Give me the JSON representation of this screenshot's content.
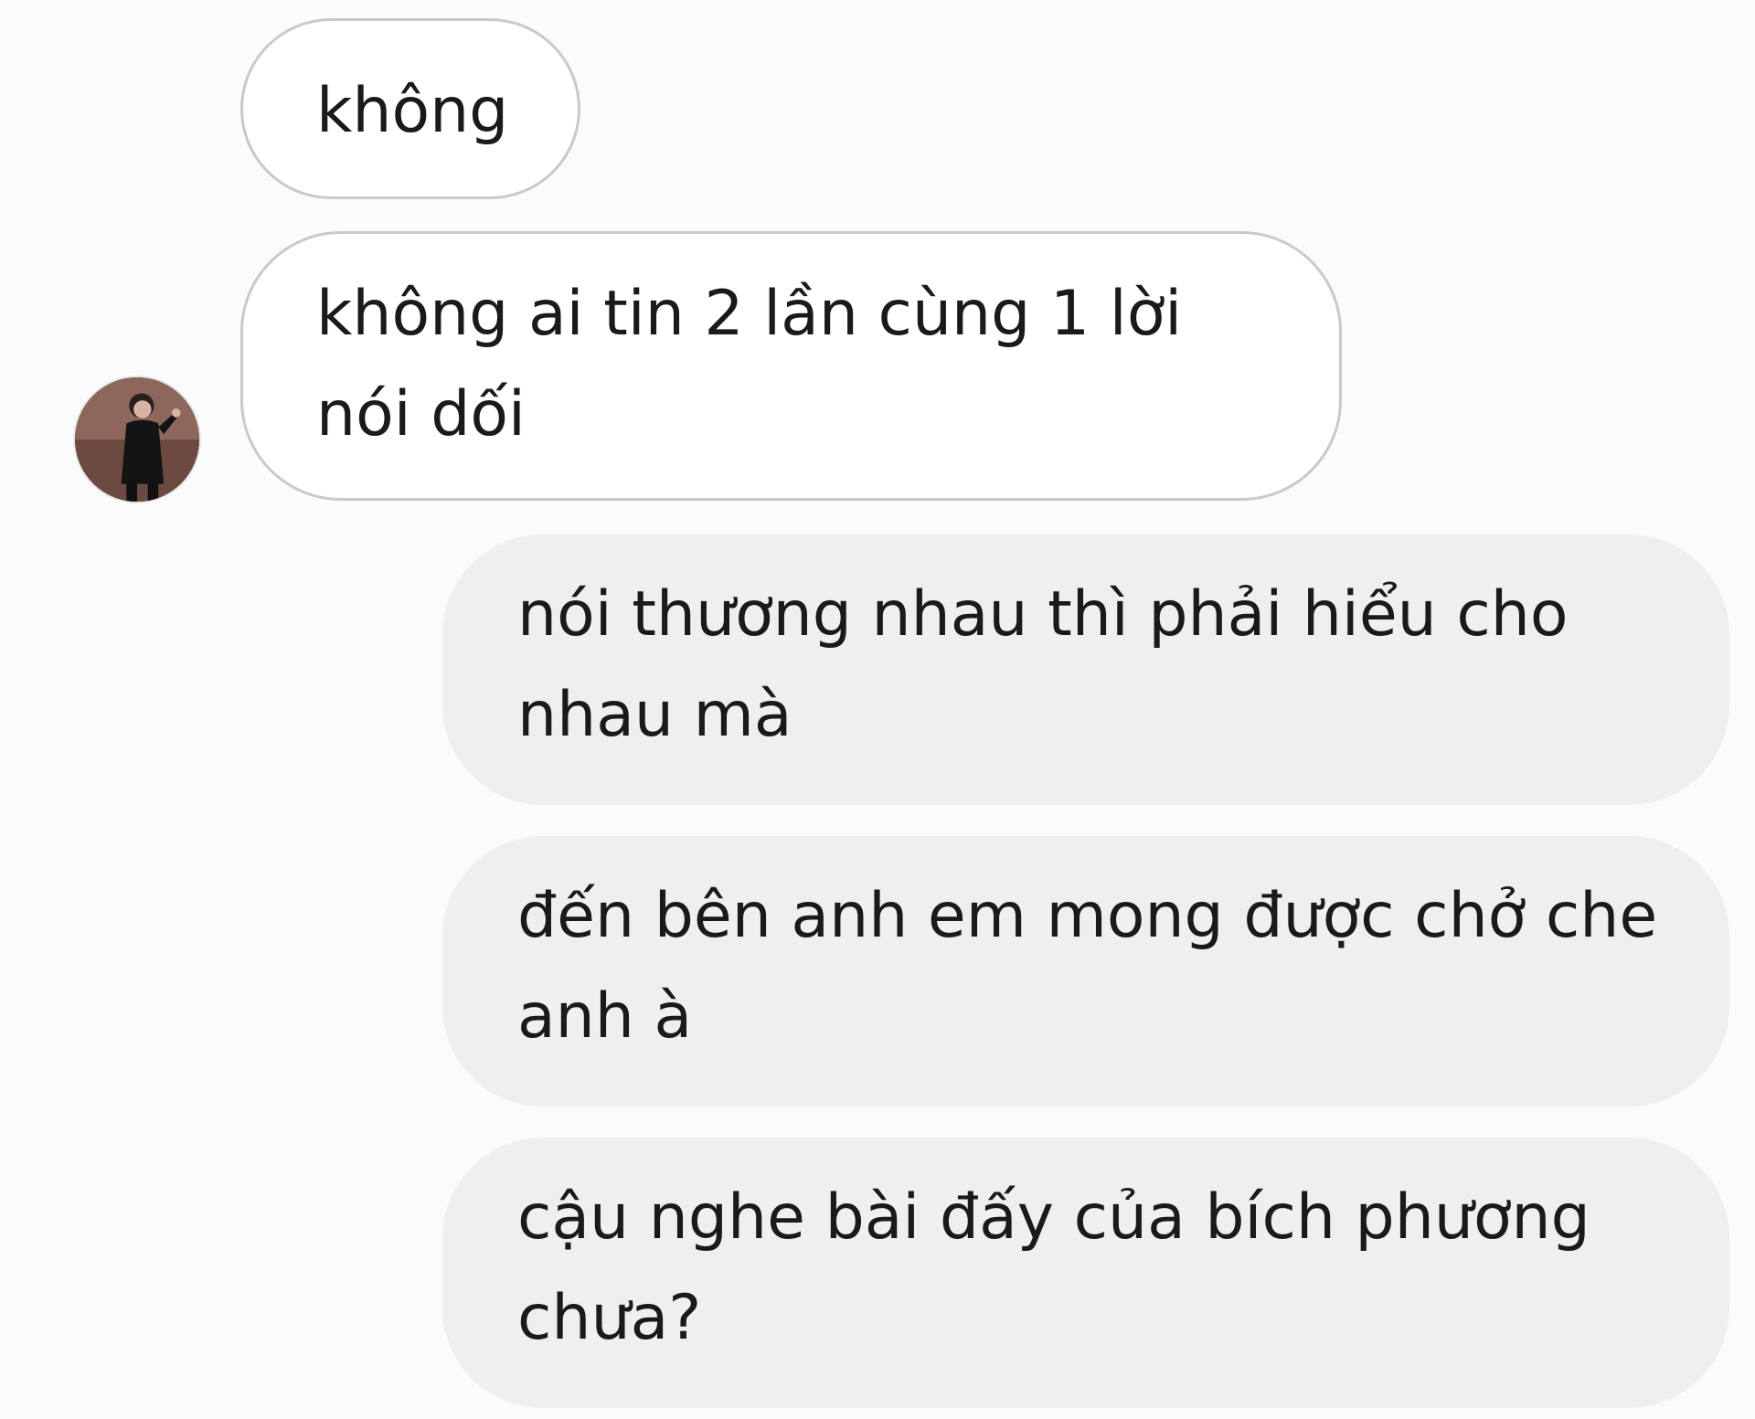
{
  "conversation": {
    "incoming": [
      {
        "text": "không"
      },
      {
        "text": "không ai tin 2 lần cùng 1 lời nói dối"
      }
    ],
    "outgoing": [
      {
        "text": "nói thương nhau thì phải hiểu cho nhau mà"
      },
      {
        "text": "đến bên anh em mong được chở che anh à"
      },
      {
        "text": "cậu nghe bài đấy của bích phương chưa?"
      }
    ]
  },
  "avatar": {
    "icon": "contact-avatar-photo"
  },
  "colors": {
    "background": "#fbfbfb",
    "incoming_bubble": "#ffffff",
    "incoming_border": "#c9c9c9",
    "outgoing_bubble": "#efefef",
    "text": "#1a1a1a"
  }
}
